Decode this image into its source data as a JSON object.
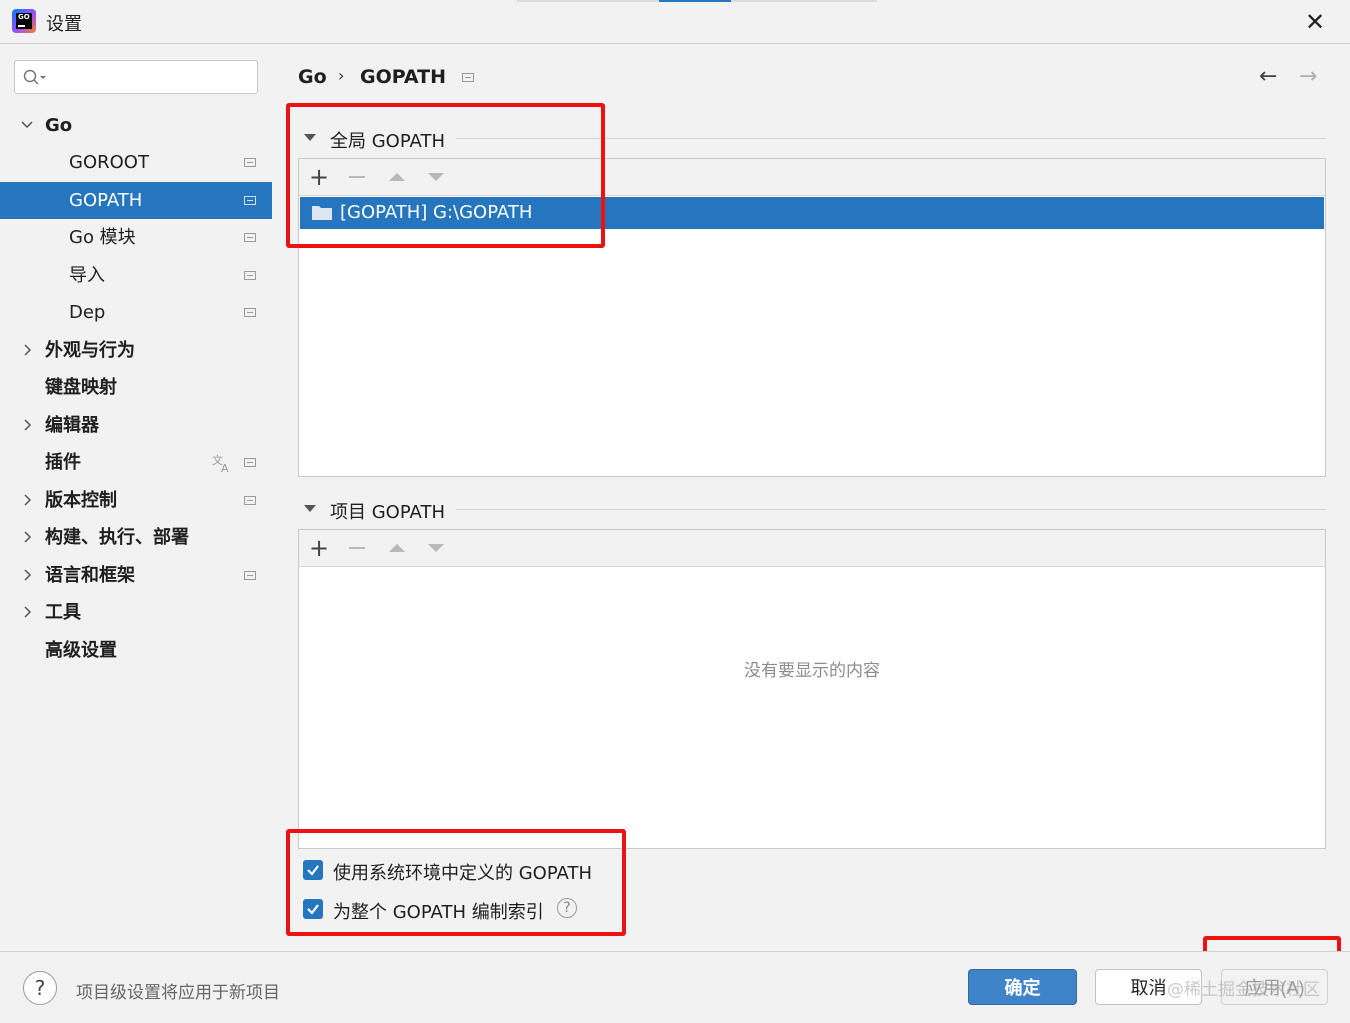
{
  "window": {
    "title": "设置"
  },
  "sidebar": {
    "search_placeholder": "",
    "items": [
      {
        "label": "Go"
      },
      {
        "label": "GOROOT"
      },
      {
        "label": "GOPATH"
      },
      {
        "label": "Go 模块"
      },
      {
        "label": "导入"
      },
      {
        "label": "Dep"
      },
      {
        "label": "外观与行为"
      },
      {
        "label": "键盘映射"
      },
      {
        "label": "编辑器"
      },
      {
        "label": "插件"
      },
      {
        "label": "版本控制"
      },
      {
        "label": "构建、执行、部署"
      },
      {
        "label": "语言和框架"
      },
      {
        "label": "工具"
      },
      {
        "label": "高级设置"
      }
    ]
  },
  "breadcrumb": {
    "root": "Go",
    "current": "GOPATH"
  },
  "global_gopath": {
    "title": "全局 GOPATH",
    "entries": [
      "[GOPATH] G:\\GOPATH"
    ]
  },
  "project_gopath": {
    "title": "项目 GOPATH",
    "empty_text": "没有要显示的内容"
  },
  "options": {
    "use_system_gopath": "使用系统环境中定义的 GOPATH",
    "index_entire_gopath": "为整个 GOPATH 编制索引"
  },
  "footer": {
    "hint": "项目级设置将应用于新项目",
    "ok_label": "确定",
    "cancel_label": "取消",
    "apply_label": "应用(A)",
    "watermark": "@稀土掘金技术社区"
  },
  "colors": {
    "accent": "#2675bf",
    "highlight": "#ee1111"
  }
}
